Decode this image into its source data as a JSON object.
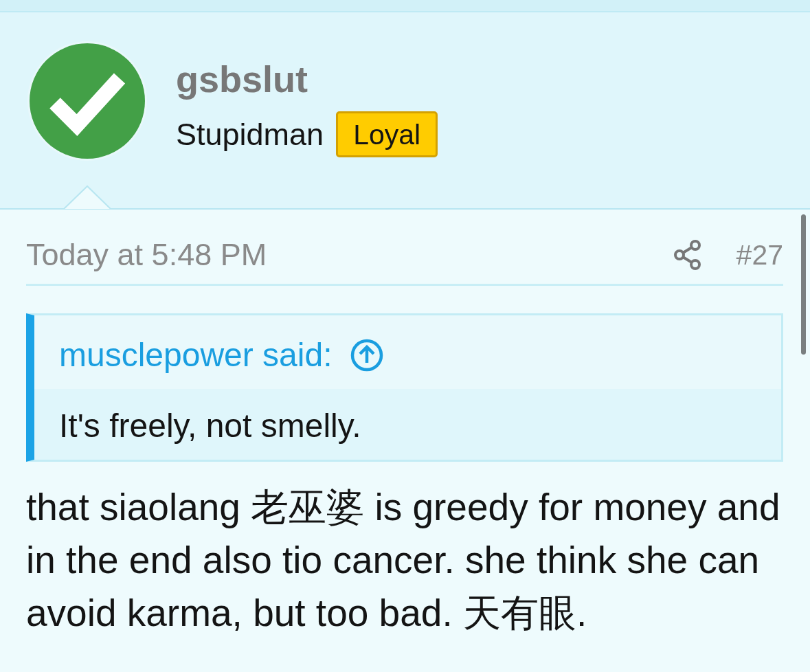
{
  "author": {
    "username": "gsbslut",
    "title": "Stupidman",
    "badge": "Loyal"
  },
  "post": {
    "date": "Today at 5:48 PM",
    "number": "#27",
    "quote": {
      "author": "musclepower said:",
      "text": "It's freely, not smelly."
    },
    "message": "that siaolang 老巫婆 is greedy for money and in the end also tio cancer. she think she can avoid karma, but too bad. 天有眼."
  }
}
